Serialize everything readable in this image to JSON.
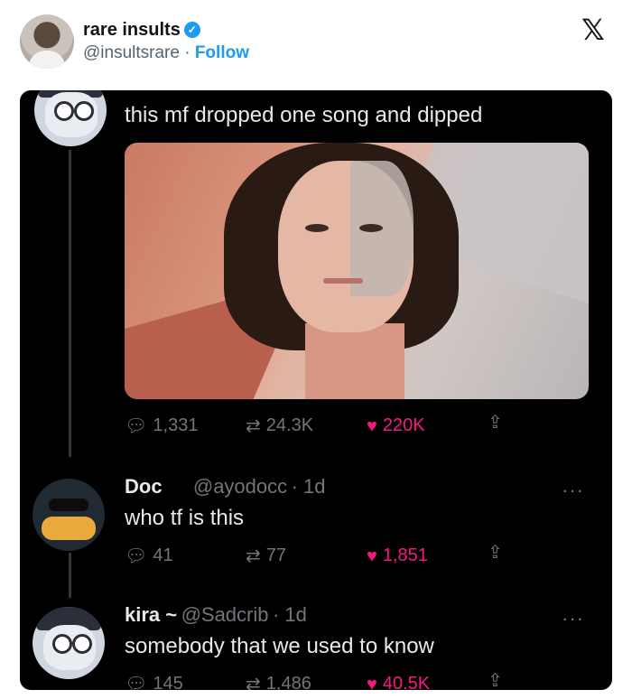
{
  "embed": {
    "author_name": "rare insults",
    "author_handle": "@insultsrare",
    "separator": "·",
    "follow_label": "Follow",
    "x_logo": "𝕏"
  },
  "thread": {
    "main_tweet": {
      "text": "this mf dropped one song and dipped",
      "replies": "1,331",
      "retweets": "24.3K",
      "likes": "220K"
    },
    "replies": [
      {
        "name": "Doc",
        "handle": "@ayodocc",
        "time": "· 1d",
        "text": "who tf is this",
        "replies": "41",
        "retweets": "77",
        "likes": "1,851",
        "more": "···"
      },
      {
        "name": "kira ~",
        "handle": "@Sadcrib",
        "time": "· 1d",
        "text": "somebody that we used to know",
        "replies": "145",
        "retweets": "1,486",
        "likes": "40.5K",
        "more": "···"
      }
    ]
  },
  "icons": {
    "reply": "reply-icon",
    "retweet": "retweet-icon",
    "like": "heart-icon",
    "share": "share-icon",
    "verified": "verified-badge-icon"
  },
  "colors": {
    "accent": "#1d9bf0",
    "like": "#f91880",
    "background_dark": "#000000",
    "muted": "#71767b"
  }
}
